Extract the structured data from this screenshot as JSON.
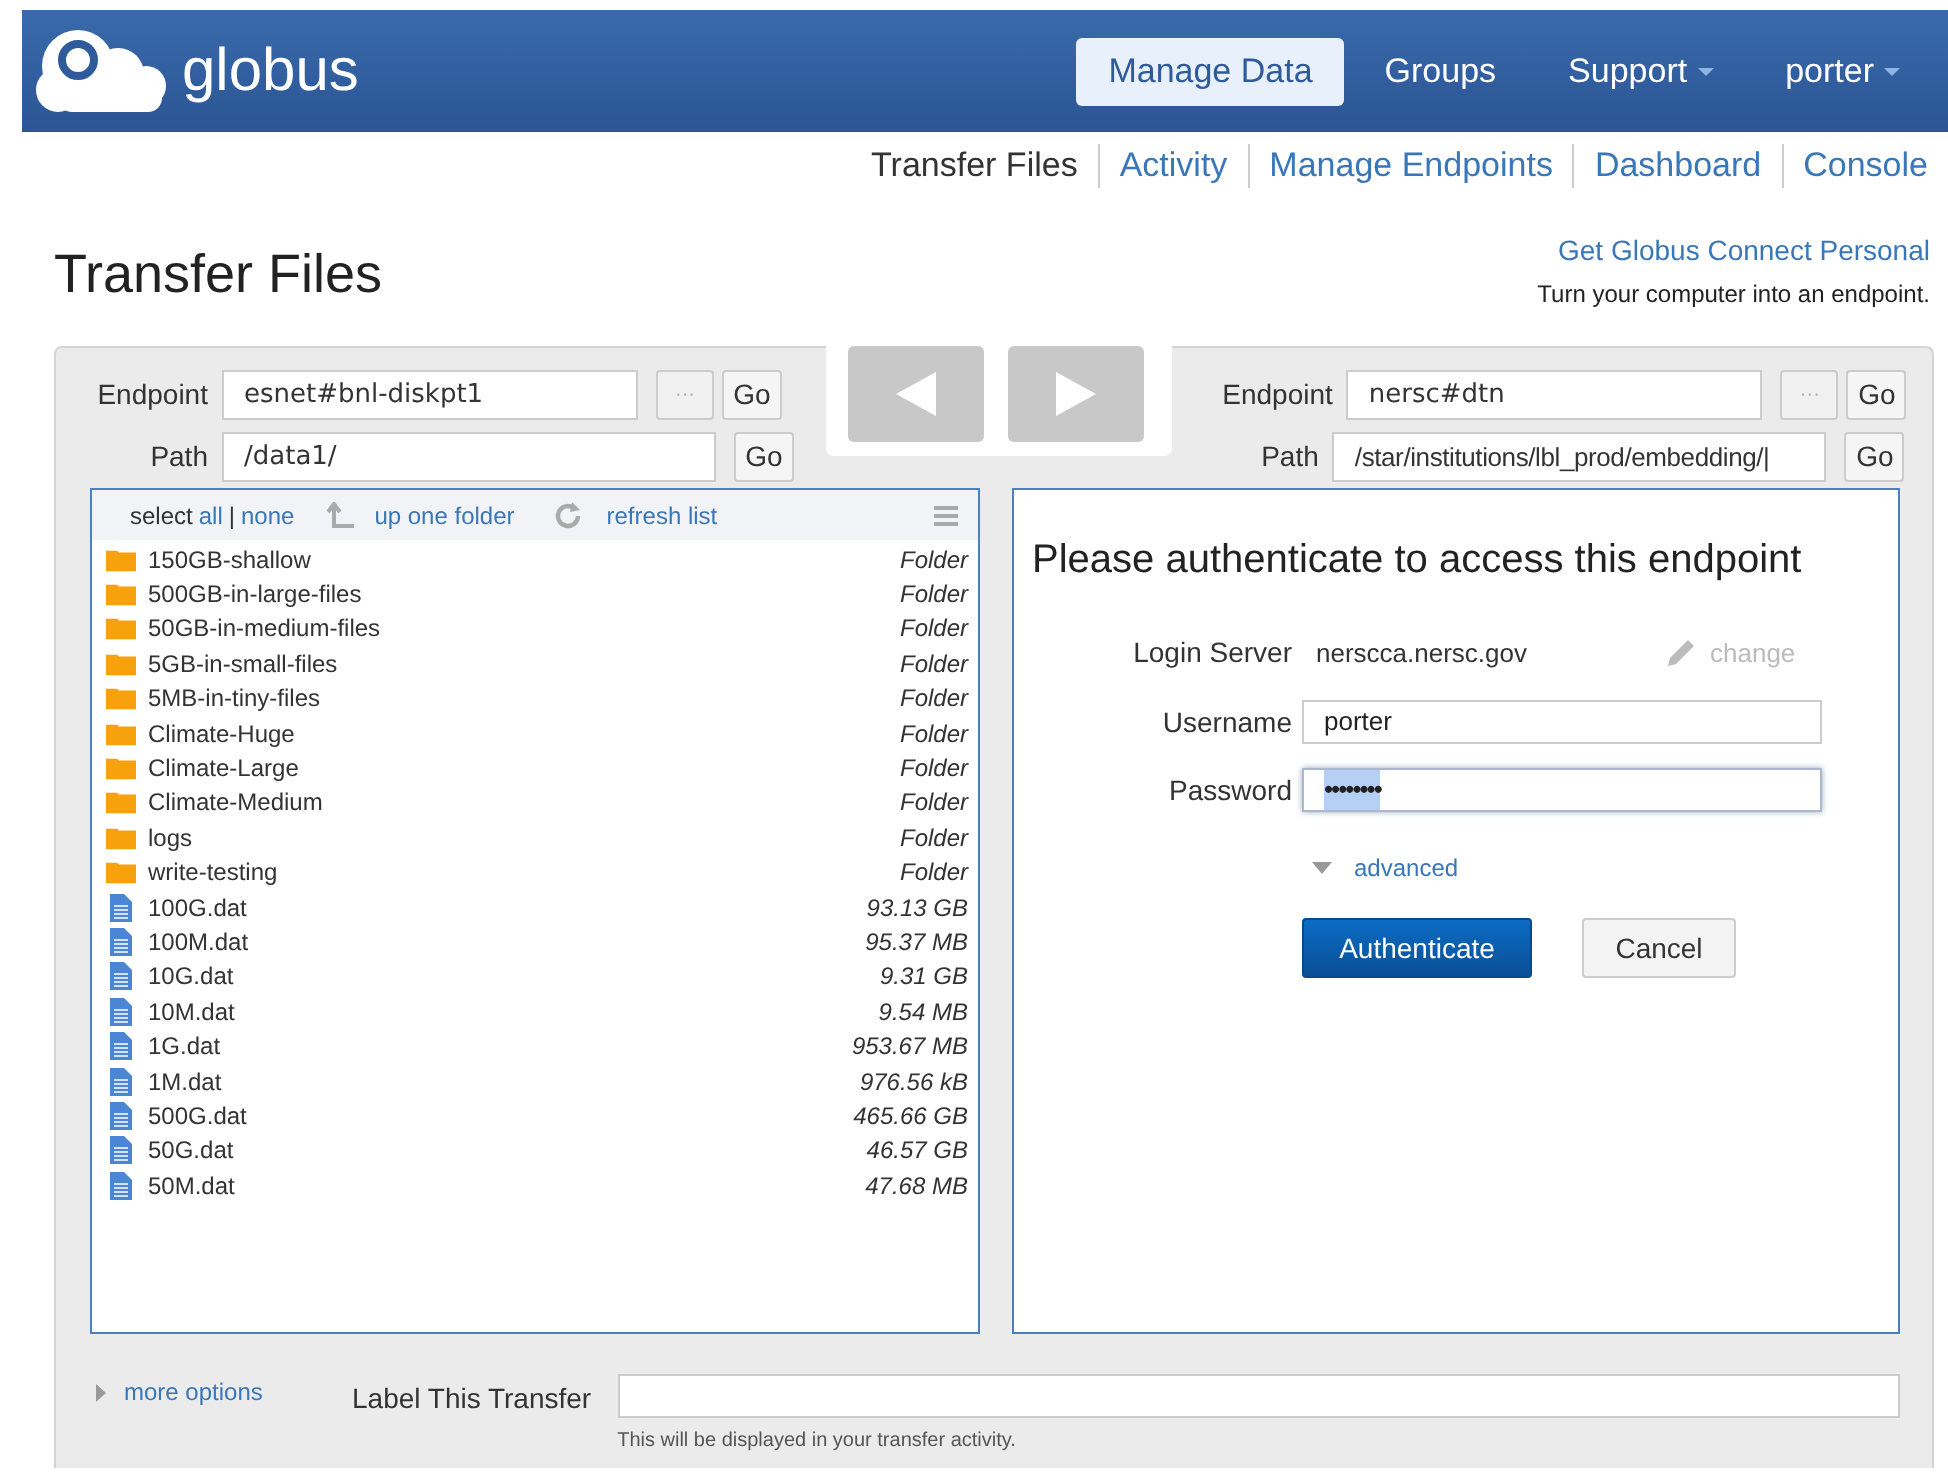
{
  "header": {
    "logo_text": "globus",
    "nav": [
      {
        "label": "Manage Data",
        "selected": true,
        "dropdown": false
      },
      {
        "label": "Groups",
        "selected": false,
        "dropdown": false
      },
      {
        "label": "Support",
        "selected": false,
        "dropdown": true
      },
      {
        "label": "porter",
        "selected": false,
        "dropdown": true
      }
    ]
  },
  "subnav": [
    {
      "label": "Transfer Files",
      "selected": true
    },
    {
      "label": "Activity",
      "selected": false
    },
    {
      "label": "Manage Endpoints",
      "selected": false
    },
    {
      "label": "Dashboard",
      "selected": false
    },
    {
      "label": "Console",
      "selected": false
    }
  ],
  "page_title": "Transfer Files",
  "promo": {
    "link": "Get Globus Connect Personal",
    "text": "Turn your computer into an endpoint."
  },
  "left": {
    "endpoint_label": "Endpoint",
    "endpoint": "esnet#bnl-diskpt1",
    "browse": "···",
    "go": "Go",
    "path_label": "Path",
    "path": "/data1/",
    "path_go": "Go",
    "toolbar": {
      "select": "select",
      "all": "all",
      "separator": "|",
      "none": "none",
      "up": "up one folder",
      "refresh": "refresh list"
    },
    "files": [
      {
        "kind": "folder",
        "name": "150GB-shallow",
        "size": "Folder"
      },
      {
        "kind": "folder",
        "name": "500GB-in-large-files",
        "size": "Folder"
      },
      {
        "kind": "folder",
        "name": "50GB-in-medium-files",
        "size": "Folder"
      },
      {
        "kind": "folder",
        "name": "5GB-in-small-files",
        "size": "Folder"
      },
      {
        "kind": "folder",
        "name": "5MB-in-tiny-files",
        "size": "Folder"
      },
      {
        "kind": "folder",
        "name": "Climate-Huge",
        "size": "Folder"
      },
      {
        "kind": "folder",
        "name": "Climate-Large",
        "size": "Folder"
      },
      {
        "kind": "folder",
        "name": "Climate-Medium",
        "size": "Folder"
      },
      {
        "kind": "folder",
        "name": "logs",
        "size": "Folder"
      },
      {
        "kind": "folder",
        "name": "write-testing",
        "size": "Folder"
      },
      {
        "kind": "file",
        "name": "100G.dat",
        "size": "93.13 GB"
      },
      {
        "kind": "file",
        "name": "100M.dat",
        "size": "95.37 MB"
      },
      {
        "kind": "file",
        "name": "10G.dat",
        "size": "9.31 GB"
      },
      {
        "kind": "file",
        "name": "10M.dat",
        "size": "9.54 MB"
      },
      {
        "kind": "file",
        "name": "1G.dat",
        "size": "953.67 MB"
      },
      {
        "kind": "file",
        "name": "1M.dat",
        "size": "976.56 kB"
      },
      {
        "kind": "file",
        "name": "500G.dat",
        "size": "465.66 GB"
      },
      {
        "kind": "file",
        "name": "50G.dat",
        "size": "46.57 GB"
      },
      {
        "kind": "file",
        "name": "50M.dat",
        "size": "47.68 MB"
      }
    ]
  },
  "right": {
    "endpoint_label": "Endpoint",
    "endpoint": "nersc#dtn",
    "browse": "···",
    "go": "Go",
    "path_label": "Path",
    "path": "/star/institutions/lbl_prod/embedding/|",
    "path_go": "Go",
    "auth": {
      "title": "Please authenticate to access this endpoint",
      "server_label": "Login Server",
      "server": "nerscca.nersc.gov",
      "change": "change",
      "username_label": "Username",
      "username": "porter",
      "password_label": "Password",
      "password": "••••••••",
      "advanced": "advanced",
      "submit": "Authenticate",
      "cancel": "Cancel"
    }
  },
  "bottom": {
    "more_options": "more options",
    "label_title": "Label This Transfer",
    "hint": "This will be displayed in your transfer activity."
  }
}
